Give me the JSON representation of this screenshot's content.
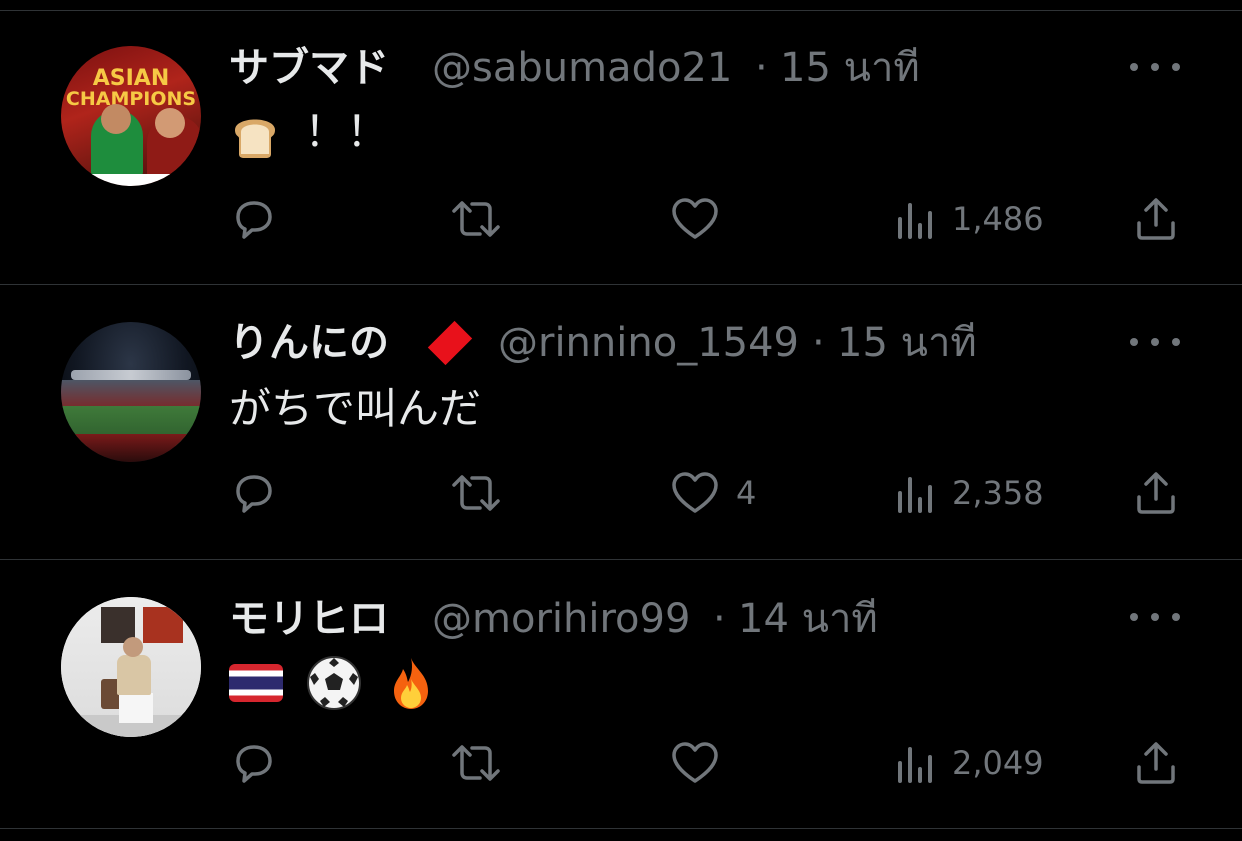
{
  "tweets": [
    {
      "display_name": "サブマド",
      "handle": "@sabumado21",
      "separator": "·",
      "time": "15 นาที",
      "text": "！！",
      "avatar_text_line1": "ASIAN",
      "avatar_text_line2": "CHAMPIONS",
      "emoji": [
        "bread"
      ],
      "counts": {
        "replies": "",
        "retweets": "",
        "likes": "",
        "views": "1,486"
      }
    },
    {
      "display_name": "りんにの",
      "handle": "@rinnino_1549",
      "separator": "·",
      "time": "15 นาที",
      "text": "がちで叫んだ",
      "emoji": [
        "red-diamond"
      ],
      "counts": {
        "replies": "",
        "retweets": "",
        "likes": "4",
        "views": "2,358"
      }
    },
    {
      "display_name": "モリヒロ",
      "handle": "@morihiro99",
      "separator": "·",
      "time": "14 นาที",
      "text": "",
      "emoji": [
        "thailand-flag",
        "soccer-ball",
        "fire"
      ],
      "counts": {
        "replies": "",
        "retweets": "",
        "likes": "",
        "views": "2,049"
      }
    }
  ],
  "icons": {
    "reply": "reply-icon",
    "retweet": "retweet-icon",
    "like": "heart-icon",
    "views": "views-icon",
    "share": "share-icon",
    "more": "more-icon"
  },
  "colors": {
    "background": "#000000",
    "primary_text": "#e7e9ea",
    "secondary_text": "#71767b",
    "divider": "#2f3336"
  }
}
